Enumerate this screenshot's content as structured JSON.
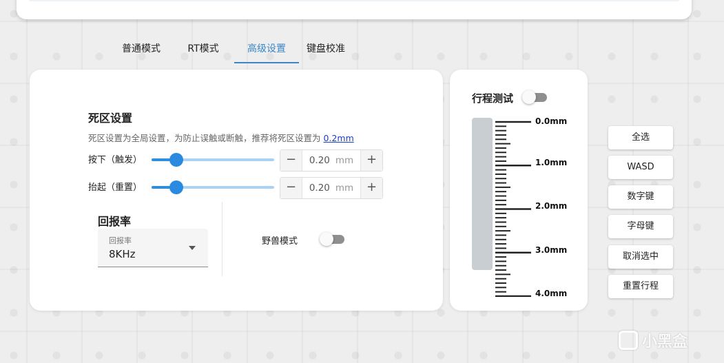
{
  "tabs": [
    {
      "label": "普通模式"
    },
    {
      "label": "RT模式"
    },
    {
      "label": "高级设置"
    },
    {
      "label": "键盘校准"
    }
  ],
  "active_tab_index": 2,
  "deadzone": {
    "title": "死区设置",
    "description": "死区设置为全局设置，为防止误触或断触，推荐将死区设置为",
    "recommend_link": "0.2mm",
    "press": {
      "label": "按下（触发）",
      "value": "0.20",
      "unit": "mm",
      "fraction": 0.2
    },
    "release": {
      "label": "抬起（重置）",
      "value": "0.20",
      "unit": "mm",
      "fraction": 0.2
    },
    "minus_glyph": "−",
    "plus_glyph": "+"
  },
  "polling": {
    "title": "回报率",
    "select_label": "回报率",
    "select_value": "8KHz"
  },
  "beast_mode": {
    "label": "野兽模式",
    "enabled": false
  },
  "travel_test": {
    "title": "行程测试",
    "enabled": false,
    "scale_labels": [
      "0.0mm",
      "1.0mm",
      "2.0mm",
      "3.0mm",
      "4.0mm"
    ]
  },
  "side_buttons": [
    "全选",
    "WASD",
    "数字键",
    "字母键",
    "取消选中",
    "重置行程"
  ],
  "watermark": "小黑盒",
  "colors": {
    "accent": "#3a86c8",
    "slider": "#2a8ae0",
    "link": "#1a3ec8"
  }
}
